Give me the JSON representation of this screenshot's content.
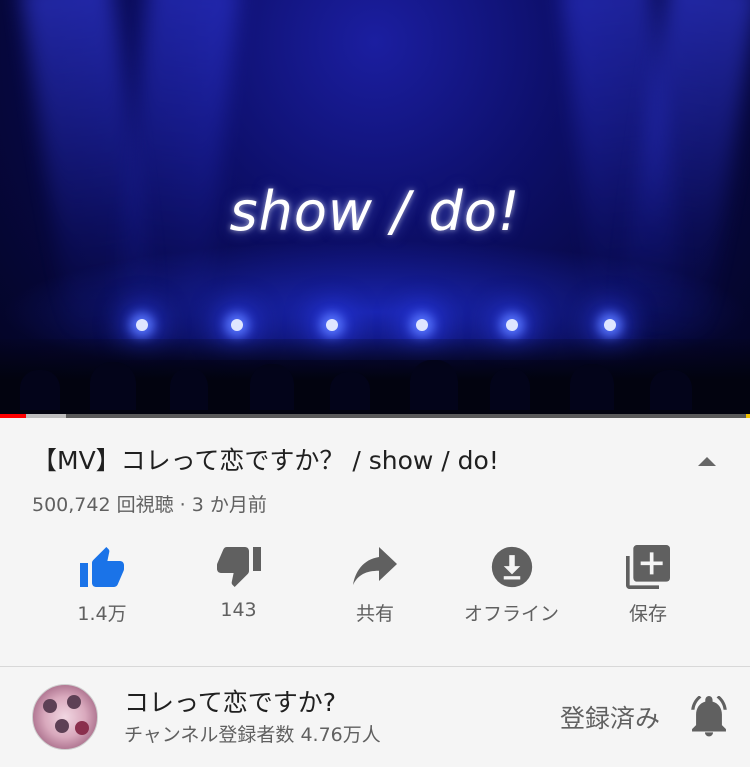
{
  "video": {
    "overlay_text": "show / do!",
    "progress": {
      "played_fraction": 0.035,
      "buffered_fraction": 0.088
    }
  },
  "info": {
    "title": "【MV】コレって恋ですか？ / show / do!",
    "meta": "500,742 回視聴 · 3 か月前",
    "collapse_icon": "chevron-up-icon"
  },
  "actions": [
    {
      "id": "like",
      "icon": "thumbs-up-icon",
      "label": "1.4万",
      "color": "#1a73e8"
    },
    {
      "id": "dislike",
      "icon": "thumbs-down-icon",
      "label": "143",
      "color": "#606060"
    },
    {
      "id": "share",
      "icon": "share-icon",
      "label": "共有",
      "color": "#606060"
    },
    {
      "id": "offline",
      "icon": "download-icon",
      "label": "オフライン",
      "color": "#606060"
    },
    {
      "id": "save",
      "icon": "playlist-add-icon",
      "label": "保存",
      "color": "#606060"
    }
  ],
  "channel": {
    "name": "コレって恋ですか?",
    "subscribers": "チャンネル登録者数 4.76万人",
    "subscribed_label": "登録済み",
    "bell_icon": "bell-icon"
  },
  "colors": {
    "accent": "#1a73e8",
    "progress_played": "#ff0000",
    "background": "#f5f5f5"
  }
}
